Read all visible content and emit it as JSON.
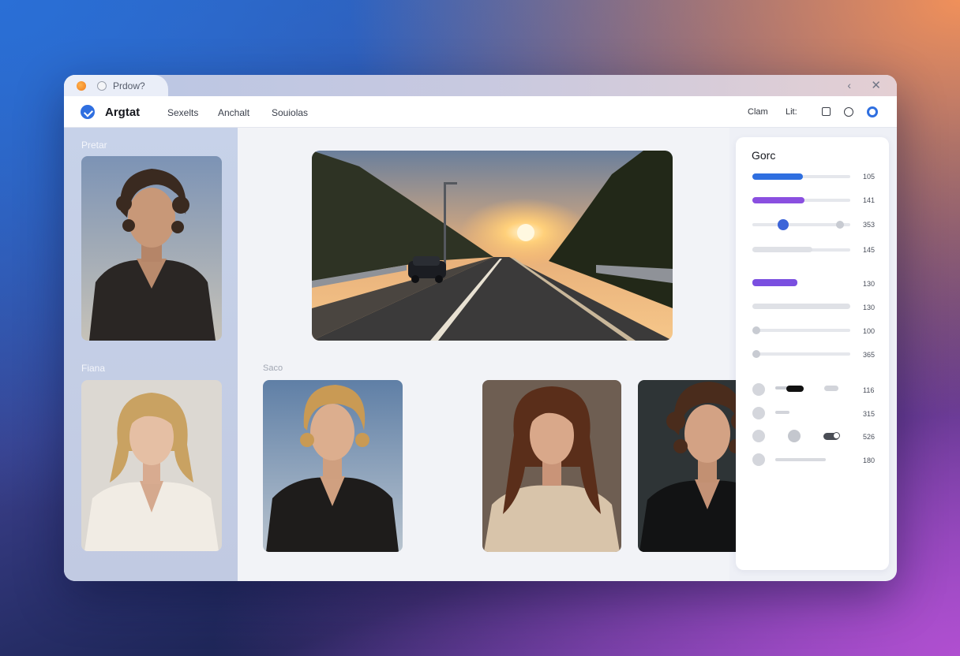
{
  "window": {
    "tab_title": "Prdow?",
    "back_icon": "chevron-left-icon",
    "close_icon": "close-icon"
  },
  "header": {
    "app_title": "Argtat",
    "nav": [
      "Sexelts",
      "Anchalt",
      "Souiolas"
    ],
    "right_labels": [
      "Clam",
      "Lit:"
    ],
    "icons": [
      "square-icon",
      "circle-icon",
      "ring-icon"
    ],
    "accent": "#2f6fe0"
  },
  "sidebar": {
    "label_top": "Pretar",
    "label_bottom": "Fiana"
  },
  "main": {
    "gallery_label": "Saco"
  },
  "panel": {
    "title": "Gorc",
    "sliders": [
      {
        "value_label": "105",
        "level": 0.5,
        "color": "#2f6fe0"
      },
      {
        "value_label": "141",
        "level": 0.5,
        "color": "#8a4fe0"
      },
      {
        "value_label": "353",
        "level": 0.3,
        "color": "#3c64d8"
      },
      {
        "value_label": "145",
        "level": 0.6,
        "color": "#dfe1e6"
      },
      {
        "value_label": "130",
        "level": 0.45,
        "color": "#7a4fe0"
      },
      {
        "value_label": "130",
        "level": 0.0,
        "color": "#dfe1e6"
      },
      {
        "value_label": "100",
        "level": 0.0,
        "color": "#dfe1e6"
      },
      {
        "value_label": "365",
        "level": 0.0,
        "color": "#dfe1e6"
      }
    ],
    "rows": [
      {
        "value_label": "116"
      },
      {
        "value_label": "315"
      },
      {
        "value_label": "526"
      },
      {
        "value_label": "180"
      }
    ]
  }
}
